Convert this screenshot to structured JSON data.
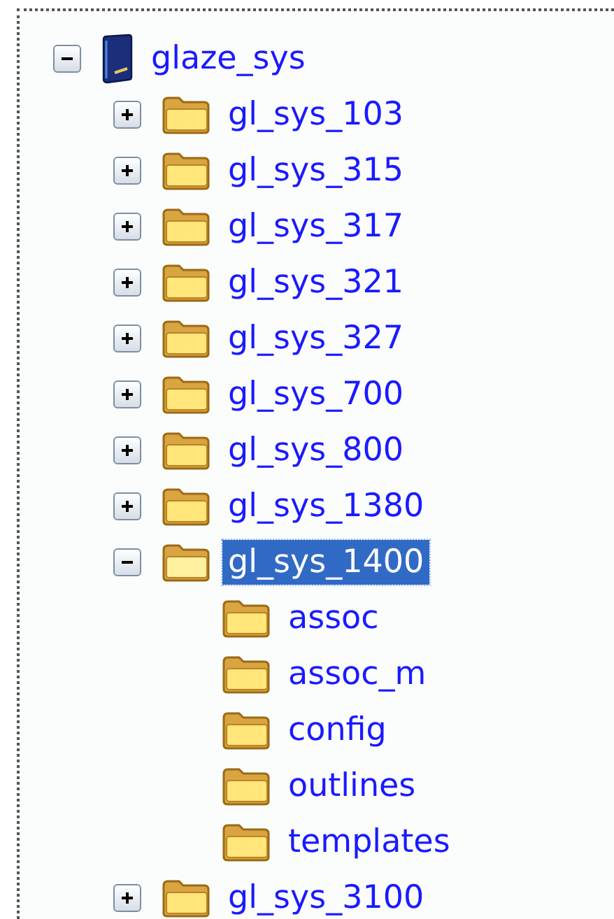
{
  "tree": {
    "label": "glaze_sys",
    "expanded": true,
    "selected": false,
    "children": [
      {
        "label": "gl_sys_103",
        "expanded": false,
        "selected": false
      },
      {
        "label": "gl_sys_315",
        "expanded": false,
        "selected": false
      },
      {
        "label": "gl_sys_317",
        "expanded": false,
        "selected": false
      },
      {
        "label": "gl_sys_321",
        "expanded": false,
        "selected": false
      },
      {
        "label": "gl_sys_327",
        "expanded": false,
        "selected": false
      },
      {
        "label": "gl_sys_700",
        "expanded": false,
        "selected": false
      },
      {
        "label": "gl_sys_800",
        "expanded": false,
        "selected": false
      },
      {
        "label": "gl_sys_1380",
        "expanded": false,
        "selected": false
      },
      {
        "label": "gl_sys_1400",
        "expanded": true,
        "selected": true,
        "children": [
          {
            "label": "assoc",
            "selected": false
          },
          {
            "label": "assoc_m",
            "selected": false
          },
          {
            "label": "config",
            "selected": false
          },
          {
            "label": "outlines",
            "selected": false
          },
          {
            "label": "templates",
            "selected": false
          }
        ]
      },
      {
        "label": "gl_sys_3100",
        "expanded": false,
        "selected": false
      }
    ]
  }
}
